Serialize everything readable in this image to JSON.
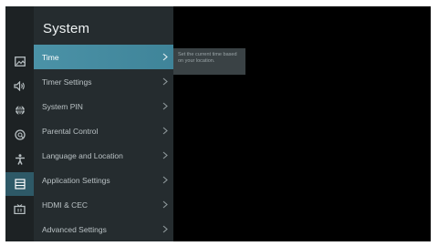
{
  "panel": {
    "title": "System"
  },
  "rail": {
    "icons": [
      {
        "name": "picture-icon"
      },
      {
        "name": "sound-icon"
      },
      {
        "name": "network-icon"
      },
      {
        "name": "channels-icon"
      },
      {
        "name": "accessibility-icon"
      },
      {
        "name": "system-icon",
        "active": true
      },
      {
        "name": "tv-support-icon"
      }
    ]
  },
  "menu": {
    "items": [
      {
        "label": "Time",
        "selected": true
      },
      {
        "label": "Timer Settings"
      },
      {
        "label": "System PIN"
      },
      {
        "label": "Parental Control"
      },
      {
        "label": "Language and Location"
      },
      {
        "label": "Application Settings"
      },
      {
        "label": "HDMI & CEC"
      },
      {
        "label": "Advanced Settings"
      }
    ]
  },
  "tooltip": {
    "text": "Set the current time based on your location."
  },
  "colors": {
    "accent": "#4b92a7",
    "panel_bg": "#252c2f",
    "rail_bg": "#1d2224",
    "screen_bg": "#000000"
  }
}
